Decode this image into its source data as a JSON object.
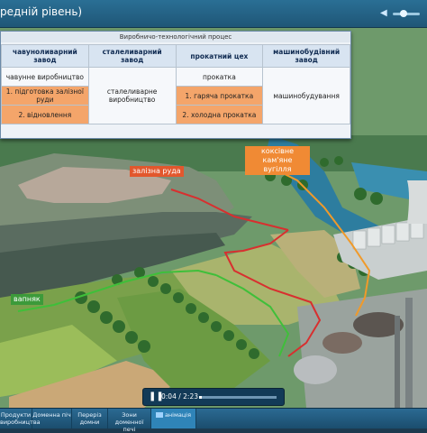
{
  "header": {
    "title": "редній рівень)"
  },
  "panel": {
    "title": "Виробничо-технологічний процес",
    "columns": [
      "чавуноливарний завод",
      "сталеливарний завод",
      "прокатний цех",
      "машинобудівний завод"
    ],
    "col1": [
      "чавунне виробництво",
      "1. підготовка залізної руди",
      "2. відновлення"
    ],
    "col2": "сталеливарне виробництво",
    "col3": [
      "прокатка",
      "1. гаряча прокатка",
      "2. холодна прокатка"
    ],
    "col4": "машинобудування"
  },
  "map_labels": {
    "iron_ore": "залізна руда",
    "coke_coal": "коксівне кам'яне вугілля",
    "limestone": "вапняк"
  },
  "player": {
    "current": "0:04",
    "total": "2:23",
    "progress": 0.03
  },
  "tabs": [
    "Продукти виробництва",
    "Доменна піч",
    "Переріз домни",
    "Зони доменної печі",
    "анімація"
  ]
}
